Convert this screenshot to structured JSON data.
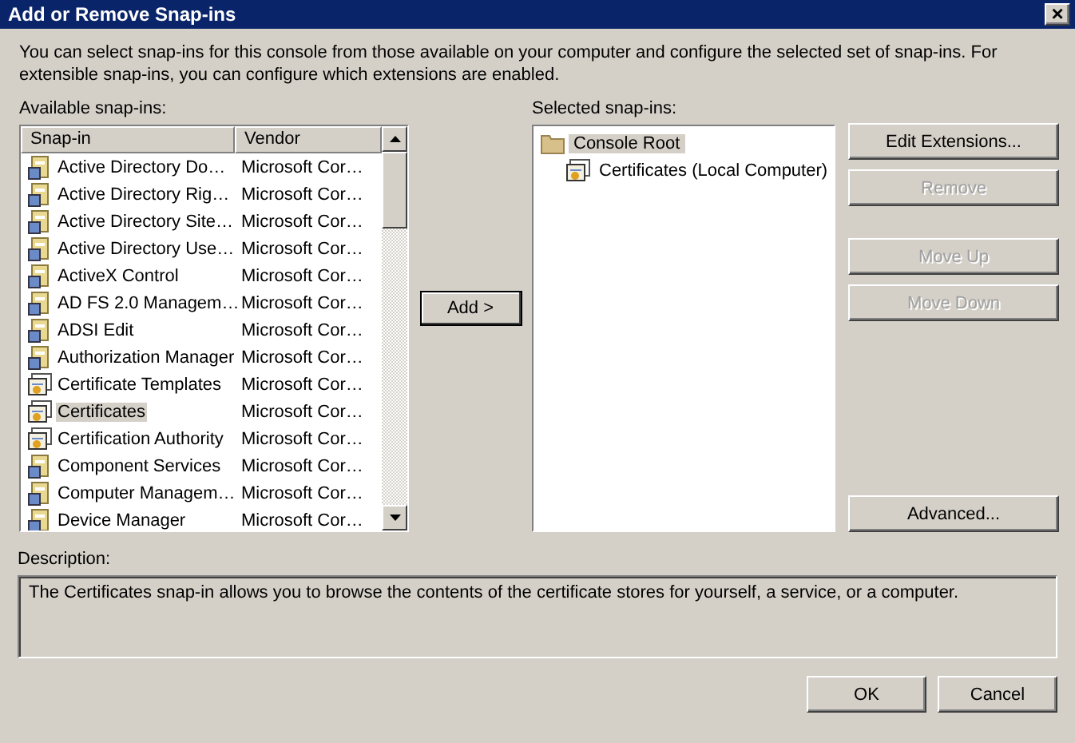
{
  "window": {
    "title": "Add or Remove Snap-ins",
    "close": "×"
  },
  "intro": "You can select snap-ins for this console from those available on your computer and configure the selected set of snap-ins. For extensible snap-ins, you can configure which extensions are enabled.",
  "available": {
    "label": "Available snap-ins:",
    "columns": [
      "Snap-in",
      "Vendor"
    ],
    "rows": [
      {
        "name": "Active Directory Do…",
        "vendor": "Microsoft Cor…",
        "selected": false
      },
      {
        "name": "Active Directory Rig…",
        "vendor": "Microsoft Cor…",
        "selected": false
      },
      {
        "name": "Active Directory Site…",
        "vendor": "Microsoft Cor…",
        "selected": false
      },
      {
        "name": "Active Directory Use…",
        "vendor": "Microsoft Cor…",
        "selected": false
      },
      {
        "name": "ActiveX Control",
        "vendor": "Microsoft Cor…",
        "selected": false
      },
      {
        "name": "AD FS 2.0 Managem…",
        "vendor": "Microsoft Cor…",
        "selected": false
      },
      {
        "name": "ADSI Edit",
        "vendor": "Microsoft Cor…",
        "selected": false
      },
      {
        "name": "Authorization Manager",
        "vendor": "Microsoft Cor…",
        "selected": false
      },
      {
        "name": "Certificate Templates",
        "vendor": "Microsoft Cor…",
        "selected": false
      },
      {
        "name": "Certificates",
        "vendor": "Microsoft Cor…",
        "selected": true
      },
      {
        "name": "Certification Authority",
        "vendor": "Microsoft Cor…",
        "selected": false
      },
      {
        "name": "Component Services",
        "vendor": "Microsoft Cor…",
        "selected": false
      },
      {
        "name": "Computer Managem…",
        "vendor": "Microsoft Cor…",
        "selected": false
      },
      {
        "name": "Device Manager",
        "vendor": "Microsoft Cor…",
        "selected": false
      }
    ]
  },
  "add_button": "Add >",
  "selected": {
    "label": "Selected snap-ins:",
    "tree": [
      {
        "label": "Console Root",
        "selected": true,
        "children": [
          {
            "label": "Certificates (Local Computer)",
            "selected": false
          }
        ]
      }
    ]
  },
  "side_buttons": [
    {
      "label": "Edit Extensions...",
      "disabled": false
    },
    {
      "label": "Remove",
      "disabled": true
    },
    {
      "label": "Move Up",
      "disabled": true
    },
    {
      "label": "Move Down",
      "disabled": true
    }
  ],
  "advanced_button": {
    "label": "Advanced...",
    "disabled": false
  },
  "description": {
    "label": "Description:",
    "text": "The Certificates snap-in allows you to browse the contents of the certificate stores for yourself, a service, or a computer."
  },
  "footer_buttons": [
    {
      "label": "OK",
      "disabled": false
    },
    {
      "label": "Cancel",
      "disabled": false
    }
  ]
}
